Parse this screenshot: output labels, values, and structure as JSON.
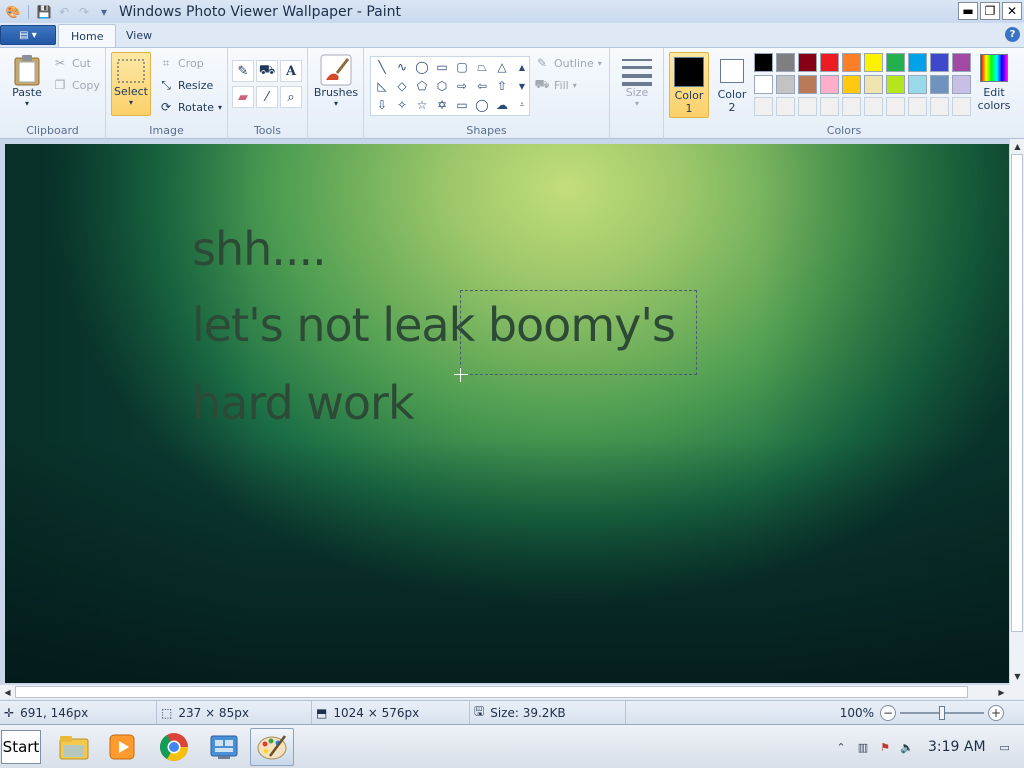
{
  "window": {
    "title": "Windows Photo Viewer Wallpaper - Paint",
    "minimize": "▬",
    "restore": "❐",
    "close": "✕"
  },
  "tabs": [
    {
      "label": "Home",
      "active": true
    },
    {
      "label": "View",
      "active": false
    }
  ],
  "ribbon": {
    "clipboard": {
      "label": "Clipboard",
      "paste": "Paste",
      "cut": "Cut",
      "copy": "Copy"
    },
    "image": {
      "label": "Image",
      "select": "Select",
      "crop": "Crop",
      "resize": "Resize",
      "rotate": "Rotate"
    },
    "tools": {
      "label": "Tools"
    },
    "brushes": {
      "label": "Brushes"
    },
    "shapes": {
      "label": "Shapes",
      "outline": "Outline",
      "fill": "Fill"
    },
    "size": {
      "label": "Size"
    },
    "colors": {
      "label": "Colors",
      "color1": "Color 1",
      "color1_line1": "Color",
      "color1_line2": "1",
      "color2_line1": "Color",
      "color2_line2": "2",
      "edit_line1": "Edit",
      "edit_line2": "colors",
      "color1_value": "#000000",
      "color2_value": "#ffffff",
      "palette_row1": [
        "#000000",
        "#7f7f7f",
        "#880015",
        "#ed1c24",
        "#ff7f27",
        "#fff200",
        "#22b14c",
        "#00a2e8",
        "#3f48cc",
        "#a349a4"
      ],
      "palette_row2": [
        "#ffffff",
        "#c3c3c3",
        "#b97a57",
        "#ffaec9",
        "#ffc90e",
        "#efe4b0",
        "#b5e61d",
        "#99d9ea",
        "#7092be",
        "#c8bfe7"
      ],
      "palette_row3": [
        "#f0f0f0",
        "#f0f0f0",
        "#f0f0f0",
        "#f0f0f0",
        "#f0f0f0",
        "#f0f0f0",
        "#f0f0f0",
        "#f0f0f0",
        "#f0f0f0",
        "#f0f0f0"
      ]
    }
  },
  "canvas": {
    "lines": [
      "shh....",
      "let's not leak boomy's",
      "hard work"
    ]
  },
  "status": {
    "cursor_pos": "691, 146px",
    "selection_size": "237 × 85px",
    "image_size": "1024 × 576px",
    "file_size": "Size: 39.2KB",
    "zoom": "100%"
  },
  "taskbar": {
    "start": "Start",
    "clock": "3:19 AM"
  }
}
